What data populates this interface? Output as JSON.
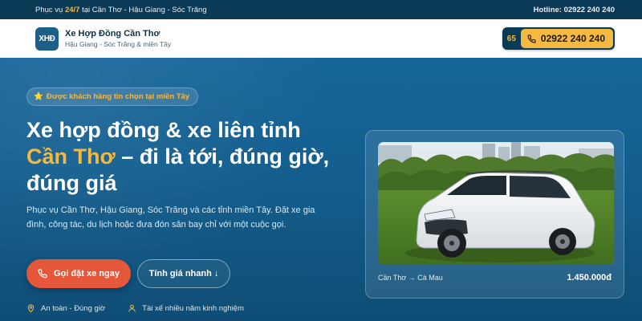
{
  "topbar": {
    "left_prefix": "Phục vụ ",
    "left_highlight": "24/7",
    "left_suffix": " tại Cần Thơ - Hậu Giang - Sóc Trăng",
    "hotline_label": "Hotline: ",
    "hotline_number": "02922 240 240"
  },
  "header": {
    "logo_text": "XHĐ",
    "brand_name": "Xe Hợp Đồng Cần Thơ",
    "brand_sub": "Hậu Giang - Sóc Trăng & miền Tây",
    "hotline_badge": "65",
    "hotline_number": "02922 240 240"
  },
  "hero": {
    "trust_chip": "Được khách hàng tin chọn tại miền Tây",
    "headline_line1": "Xe hợp đồng & xe liên tỉnh",
    "headline_accent": "Cần Thơ",
    "headline_rest": " – đi là tới, đúng giờ, đúng giá",
    "description": "Phục vụ Cần Thơ, Hậu Giang, Sóc Trăng và các tỉnh miền Tây. Đặt xe gia đình, công tác, du lịch hoặc đưa đón sân bay chỉ với một cuộc gọi.",
    "primary_button": "Gọi đặt xe ngay",
    "secondary_button": "Tính giá nhanh ↓",
    "features": [
      {
        "icon": "location-pin-icon",
        "label": "An toàn - Đúng giờ"
      },
      {
        "icon": "user-icon",
        "label": "Tài xế nhiều năm kinh nghiệm"
      }
    ]
  },
  "card": {
    "image": "white-toyota-mpv-photo",
    "route": "Cần Thơ → Cà Mau",
    "price": "1.450.000đ"
  },
  "colors": {
    "accent": "#f5b942",
    "cta": "#e5573a",
    "navy": "#0b3a57",
    "hero": "#135e8e"
  }
}
